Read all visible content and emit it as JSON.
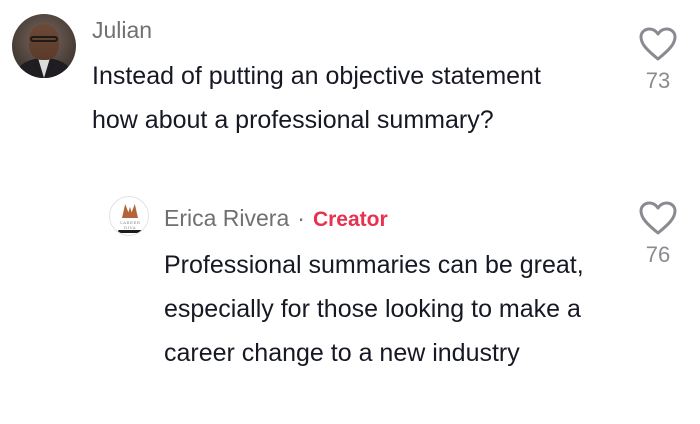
{
  "comments": {
    "main": {
      "username": "Julian",
      "text": "Instead of putting an objective statement how about a professional summary?",
      "likes": "73",
      "like_icon": "heart-outline-icon"
    },
    "reply": {
      "username": "Erica Rivera",
      "separator": "·",
      "badge": "Creator",
      "text": "Professional summaries can be great, especially for those looking to make a career change to a new industry",
      "likes": "76",
      "like_icon": "heart-outline-icon",
      "avatar_text": "CAREER DIVA"
    }
  },
  "colors": {
    "creator_badge": "#e8304f",
    "username": "#707070",
    "text": "#161823",
    "like_count": "#8a8b91"
  }
}
